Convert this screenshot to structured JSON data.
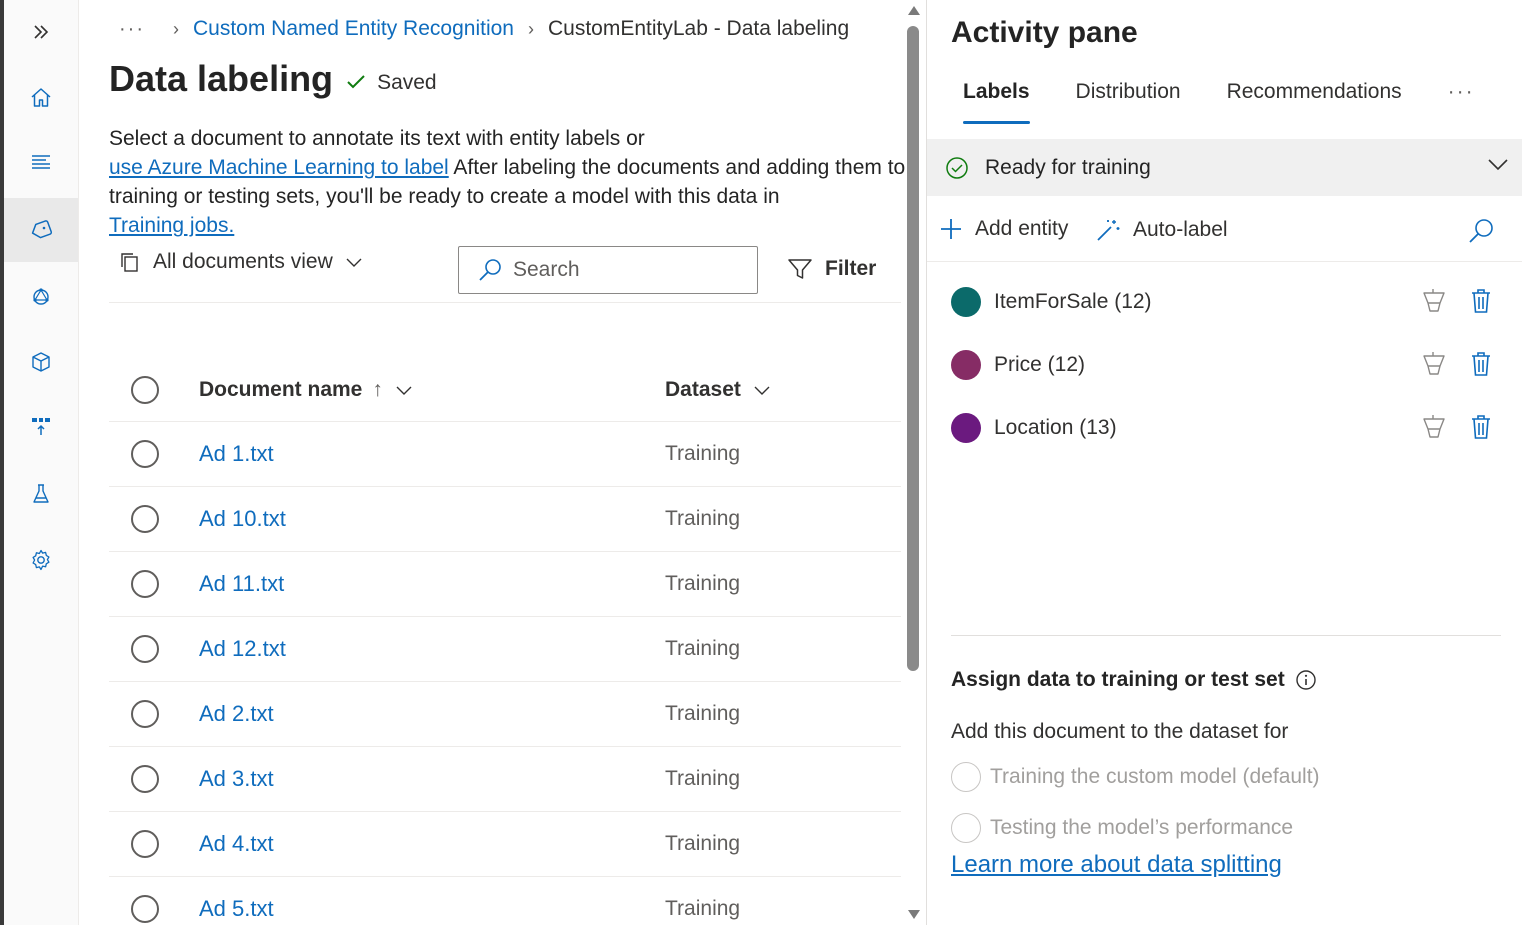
{
  "breadcrumb": {
    "overflow": "···",
    "project": "Custom Named Entity Recognition",
    "current": "CustomEntityLab - Data labeling"
  },
  "page": {
    "title": "Data labeling",
    "saved": "Saved"
  },
  "description": {
    "text1": "Select a document to annotate its text with entity labels or",
    "link1": "use Azure Machine Learning to label",
    "text2": " After labeling the documents and adding them to training or testing sets, you'll be ready to create a model with this data in",
    "link2": "Training jobs."
  },
  "toolbar": {
    "view": "All documents view",
    "search_placeholder": "Search",
    "filter": "Filter"
  },
  "grid": {
    "columns": {
      "name": "Document name",
      "sort_arrow": "↑",
      "dataset": "Dataset"
    },
    "rows": [
      {
        "name": "Ad 1.txt",
        "dataset": "Training"
      },
      {
        "name": "Ad 10.txt",
        "dataset": "Training"
      },
      {
        "name": "Ad 11.txt",
        "dataset": "Training"
      },
      {
        "name": "Ad 12.txt",
        "dataset": "Training"
      },
      {
        "name": "Ad 2.txt",
        "dataset": "Training"
      },
      {
        "name": "Ad 3.txt",
        "dataset": "Training"
      },
      {
        "name": "Ad 4.txt",
        "dataset": "Training"
      },
      {
        "name": "Ad 5.txt",
        "dataset": "Training"
      }
    ]
  },
  "pane": {
    "title": "Activity pane",
    "tabs": [
      "Labels",
      "Distribution",
      "Recommendations"
    ],
    "tab_more": "···",
    "status": "Ready for training",
    "add_entity": "Add entity",
    "auto_label": "Auto-label",
    "entities": [
      {
        "label": "ItemForSale (12)",
        "color": "#0b6a6a"
      },
      {
        "label": "Price (12)",
        "color": "#862c65"
      },
      {
        "label": "Location (13)",
        "color": "#6b1a7f"
      }
    ],
    "assign_title": "Assign data to training or test set",
    "assign_desc": "Add this document to the dataset for",
    "options": [
      "Training the custom model (default)",
      "Testing the model’s performance"
    ],
    "learn_more": "Learn more about data splitting"
  },
  "colors": {
    "accent": "#0f6cbd",
    "success": "#107c10"
  },
  "icons": [
    "expand-icon",
    "home-icon",
    "list-icon",
    "tag-icon",
    "model-icon",
    "box-icon",
    "deploy-icon",
    "flask-icon",
    "gear-icon"
  ]
}
